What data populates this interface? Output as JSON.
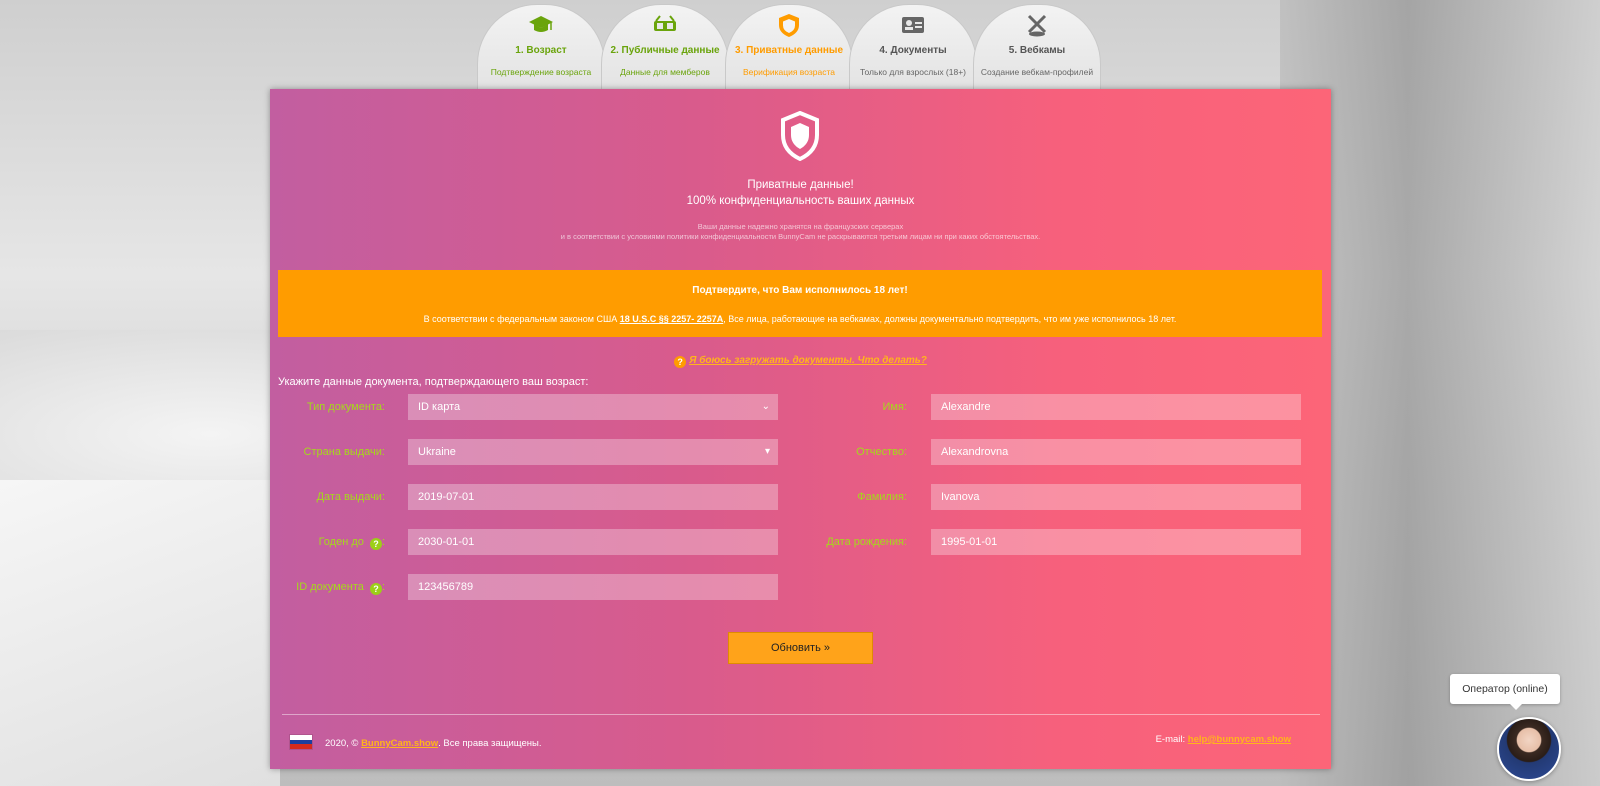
{
  "tabs": [
    {
      "title": "1. Возраст",
      "sub": "Подтверждение возраста",
      "icon": "graduation-cap-icon",
      "state": "done"
    },
    {
      "title": "2. Публичные данные",
      "sub": "Данные для мемберов",
      "icon": "glasses-icon",
      "state": "done"
    },
    {
      "title": "3. Приватные данные",
      "sub": "Верификация возраста",
      "icon": "shield-icon",
      "state": "active"
    },
    {
      "title": "4. Документы",
      "sub": "Только для взрослых (18+)",
      "icon": "id-card-icon",
      "state": "inactive"
    },
    {
      "title": "5. Вебкамы",
      "sub": "Создание вебкам-профилей",
      "icon": "microphone-icon",
      "state": "inactive"
    }
  ],
  "header": {
    "line1": "Приватные данные!",
    "line2": "100% конфиденциальность ваших данных",
    "fine1": "Ваши данные надежно хранятся на французских серверах",
    "fine2": "и в соответствии с условиями политики конфиденциальности BunnyCam не раскрываются третьим лицам ни при каких обстоятельствах."
  },
  "alert": {
    "title": "Подтвердите, что Вам исполнилось 18 лет!",
    "text_before": "В соответствии с федеральным законом США ",
    "law_link": "18 U.S.C §§ 2257- 2257A",
    "text_after": ", Все лица, работающие на вебкамах, должны документально подтвердить, что им уже исполнилось 18 лет."
  },
  "help_link": "Я боюсь загружать документы. Что делать?",
  "form": {
    "title": "Укажите данные документа, подтверждающего ваш возраст:",
    "doc_type_label": "Тип документа:",
    "doc_type_value": "ID карта",
    "country_label": "Страна выдачи:",
    "country_value": "Ukraine",
    "issue_date_label": "Дата выдачи:",
    "issue_date_value": "2019-07-01",
    "valid_until_label": "Годен до",
    "valid_until_value": "2030-01-01",
    "doc_id_label": "ID документа",
    "doc_id_value": "123456789",
    "first_name_label": "Имя:",
    "first_name_value": "Alexandre",
    "middle_name_label": "Отчество:",
    "middle_name_value": "Alexandrovna",
    "last_name_label": "Фамилия:",
    "last_name_value": "Ivanova",
    "birth_date_label": "Дата рождения:",
    "birth_date_value": "1995-01-01",
    "submit_label": "Обновить »"
  },
  "footer": {
    "copyright_before": "2020, © ",
    "brand": "BunnyCam.show",
    "copyright_after": ". Все права защищены.",
    "email_label": "E-mail: ",
    "email": "help@bunnycam.show"
  },
  "operator": {
    "bubble": "Оператор (online)"
  },
  "colors": {
    "accent_orange": "#ff9c00",
    "label_green": "#a5d81c",
    "done_green": "#6aa40c"
  }
}
